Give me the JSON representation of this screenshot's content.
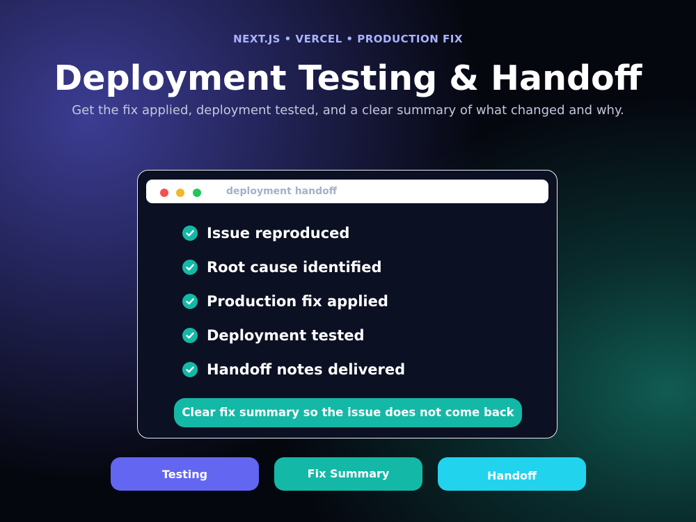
{
  "header": {
    "eyebrow": "NEXT.JS • VERCEL • PRODUCTION FIX",
    "title": "Deployment Testing & Handoff",
    "subtitle": "Get the fix applied, deployment tested, and a clear summary of what changed and why."
  },
  "window": {
    "title": "deployment handoff",
    "controls": [
      {
        "name": "close-dot",
        "color": "#f0544c"
      },
      {
        "name": "minimize-dot",
        "color": "#f5b52a"
      },
      {
        "name": "maximize-dot",
        "color": "#22c55e"
      }
    ],
    "checklist": [
      {
        "label": "Issue reproduced",
        "icon": "check-circle-icon",
        "done": true
      },
      {
        "label": "Root cause identified",
        "icon": "check-circle-icon",
        "done": true
      },
      {
        "label": "Production fix applied",
        "icon": "check-circle-icon",
        "done": true
      },
      {
        "label": "Deployment tested",
        "icon": "check-circle-icon",
        "done": true
      },
      {
        "label": "Handoff notes delivered",
        "icon": "check-circle-icon",
        "done": true
      }
    ],
    "summary": "Clear fix summary so the issue does not come back"
  },
  "buttons": [
    {
      "label": "Testing",
      "color": "#6366f1"
    },
    {
      "label": "Fix Summary",
      "color": "#14b8a6"
    },
    {
      "label": "Handoff",
      "color": "#22d3ee"
    }
  ]
}
